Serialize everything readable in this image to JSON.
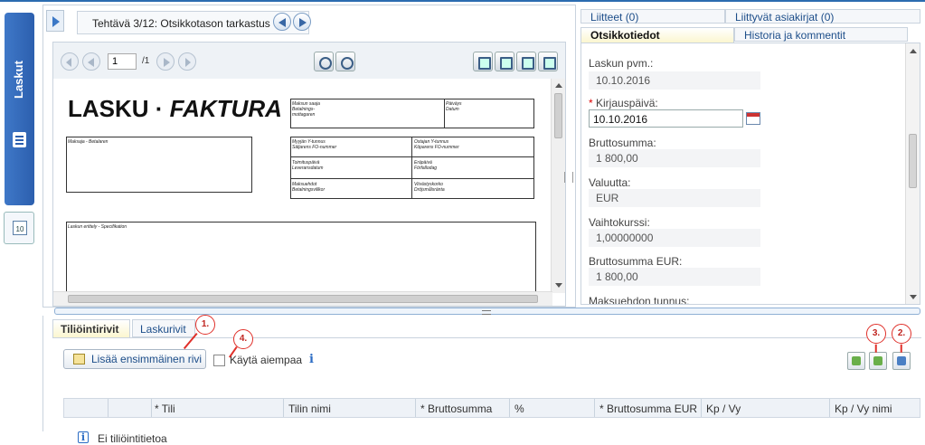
{
  "sidebar": {
    "tab_label": "Laskut",
    "cal_badge": "10"
  },
  "task": {
    "title": "Tehtävä 3/12: Otsikkotason tarkastus"
  },
  "viewer": {
    "page_value": "1",
    "page_total": "/1"
  },
  "invoice": {
    "title_bold": "LASKU · ",
    "title_italic": "FAKTURA",
    "payee": "Maksun saaja\nBetalnings-\nmottagaren",
    "date": "Päiväys\nDatum",
    "payer": "Maksaja - Betalaren",
    "seller_id": "Myyjän Y-tunnus\nSäljarens FO-nummer",
    "buyer_id": "Ostajan Y-tunnus\nKöparens FO-nummer",
    "delivery": "Toimituspäivä\nLeveransdatum",
    "due": "Eräpäivä\nFörfallodag",
    "terms": "Maksuehdot\nBetalningsvillkor",
    "penalty": "Viivästyskorko\nDröjsmålsränta",
    "spec": "Laskun erittely - Specifikation"
  },
  "right_tabs": {
    "attachments": "Liitteet (0)",
    "related_docs": "Liittyvät asiakirjat (0)",
    "header_info": "Otsikkotiedot",
    "history": "Historia ja kommentit"
  },
  "fields": [
    {
      "label": "Laskun pvm.:",
      "value": "10.10.2016"
    },
    {
      "label": "Kirjauspäivä:",
      "value": "10.10.2016",
      "required": "*"
    },
    {
      "label": "Bruttosumma:",
      "value": "1 800,00"
    },
    {
      "label": "Valuutta:",
      "value": "EUR"
    },
    {
      "label": "Vaihtokurssi:",
      "value": "1,00000000"
    },
    {
      "label": "Bruttosumma EUR:",
      "value": "1 800,00"
    },
    {
      "label": "Maksuehdon tunnus:",
      "value": ""
    }
  ],
  "bottom": {
    "tab_active": "Tiliöintirivit",
    "tab_other": "Laskurivit",
    "add_button": "Lisää ensimmäinen rivi",
    "use_previous": "Käytä aiempaa",
    "info_glyph": "i",
    "columns": [
      "* Tili",
      "Tilin nimi",
      "* Bruttosumma",
      "%",
      "* Bruttosumma EUR",
      "Kp / Vy",
      "Kp / Vy nimi"
    ],
    "empty_text": "Ei tiliöintitietoa"
  },
  "annotations": [
    "1.",
    "2.",
    "3.",
    "4."
  ],
  "colors": {
    "accent": "#2c5fae",
    "annotation": "#e0302a",
    "active_tab": "#fbf6cf"
  }
}
